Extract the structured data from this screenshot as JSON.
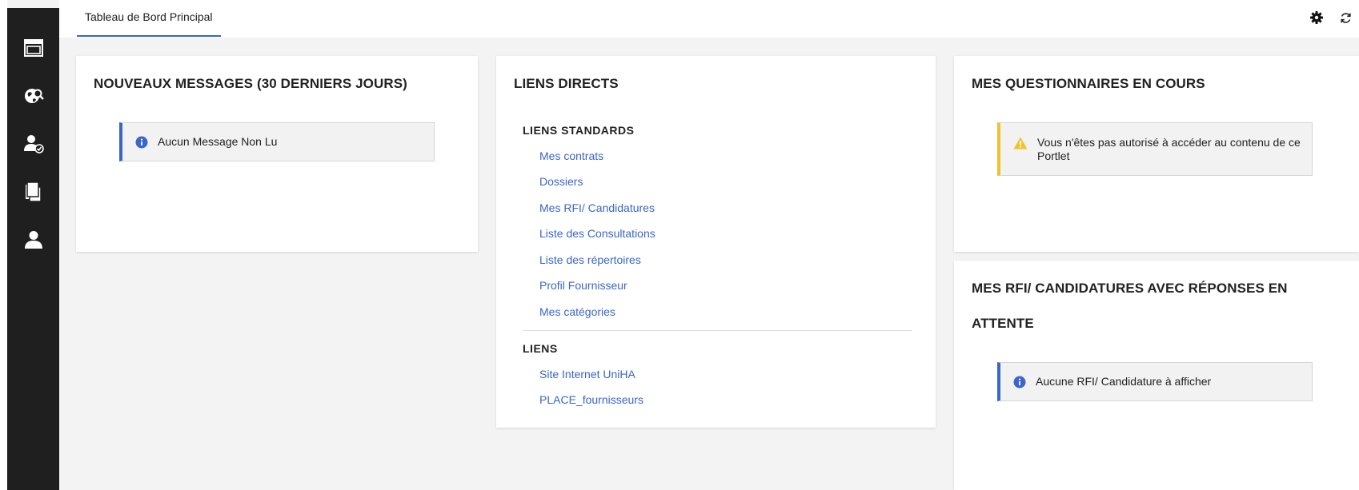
{
  "header": {
    "tab_label": "Tableau de Bord Principal",
    "accent_color": "#3a66c9"
  },
  "sidebar": {
    "items": [
      {
        "icon": "dashboard-icon"
      },
      {
        "icon": "globe-search-icon"
      },
      {
        "icon": "user-check-icon"
      },
      {
        "icon": "documents-icon"
      },
      {
        "icon": "user-icon"
      }
    ]
  },
  "toolbar": {
    "icons": [
      "gear-icon",
      "refresh-icon"
    ]
  },
  "messages_card": {
    "title": "NOUVEAUX MESSAGES (30 DERNIERS JOURS)",
    "notice": "Aucun Message Non Lu"
  },
  "links_card": {
    "title": "LIENS DIRECTS",
    "standard_section": {
      "title": "LIENS STANDARDS",
      "links": [
        "Mes contrats",
        "Dossiers",
        "Mes RFI/ Candidatures",
        "Liste des Consultations",
        "Liste des répertoires",
        "Profil Fournisseur",
        "Mes catégories"
      ]
    },
    "other_section": {
      "title": "LIENS",
      "links": [
        "Site Internet UniHA",
        "PLACE_fournisseurs"
      ]
    }
  },
  "questionnaires_card": {
    "title": "MES QUESTIONNAIRES EN COURS",
    "notice": "Vous n'êtes pas autorisé à accéder au contenu de ce Portlet",
    "warning_color": "#f2c12e"
  },
  "rfi_card": {
    "title_line1": "MES RFI/ CANDIDATURES AVEC RÉPONSES EN",
    "title_line2": "ATTENTE",
    "notice": "Aucune RFI/ Candidature à afficher"
  }
}
